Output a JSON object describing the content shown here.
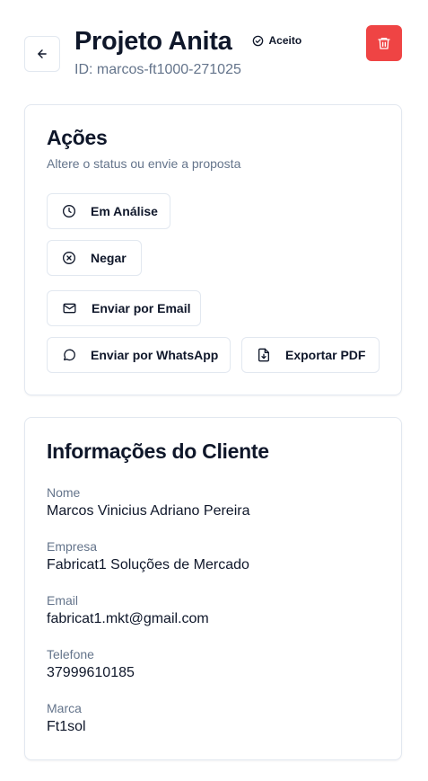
{
  "header": {
    "title": "Projeto Anita",
    "status_badge": "Aceito",
    "project_id": "ID: marcos-ft1000-271025"
  },
  "actions_card": {
    "title": "Ações",
    "description": "Altere o status ou envie a proposta",
    "buttons": [
      {
        "label": "Em Análise",
        "icon": "clock-icon"
      },
      {
        "label": "Negar",
        "icon": "x-circle-icon"
      },
      {
        "label": "Enviar por Email",
        "icon": "mail-icon"
      },
      {
        "label": "Enviar por WhatsApp",
        "icon": "whatsapp-icon"
      },
      {
        "label": "Exportar PDF",
        "icon": "file-download-icon"
      }
    ]
  },
  "client_card": {
    "title": "Informações do Cliente",
    "fields": [
      {
        "label": "Nome",
        "value": "Marcos Vinicius Adriano Pereira"
      },
      {
        "label": "Empresa",
        "value": "Fabricat1 Soluções de Mercado"
      },
      {
        "label": "Email",
        "value": "fabricat1.mkt@gmail.com"
      },
      {
        "label": "Telefone",
        "value": "37999610185"
      },
      {
        "label": "Marca",
        "value": "Ft1sol"
      }
    ]
  },
  "colors": {
    "danger": "#ef4444",
    "muted_text": "#64748b",
    "border": "#e2e8f0",
    "text": "#0f172a"
  }
}
